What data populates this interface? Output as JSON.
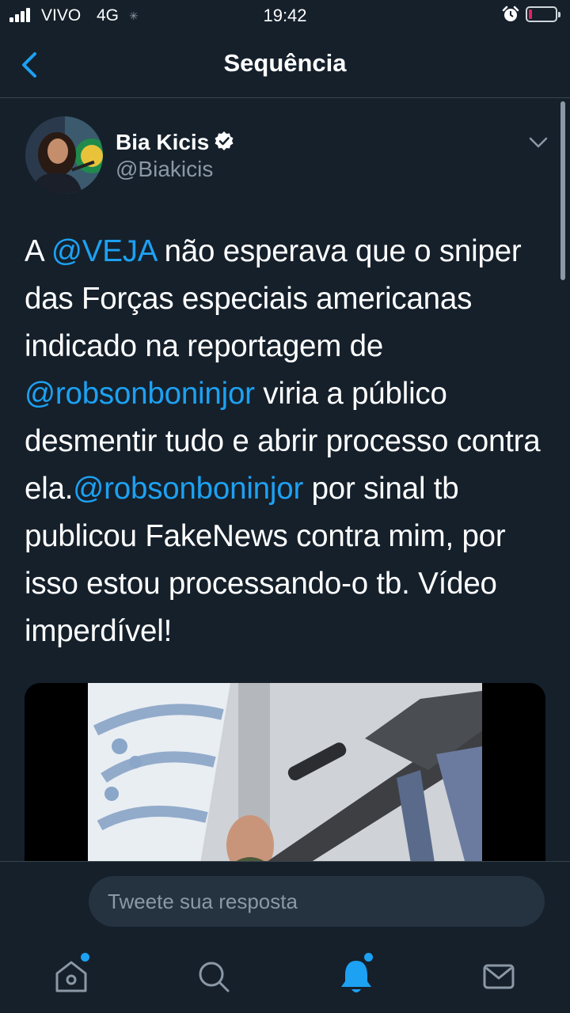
{
  "status_bar": {
    "carrier": "VIVO",
    "network": "4G",
    "time": "19:42",
    "icons": [
      "signal-icon",
      "loading-icon",
      "alarm-icon",
      "battery-icon"
    ]
  },
  "nav": {
    "title": "Sequência",
    "back_icon": "chevron-left-icon"
  },
  "tweet": {
    "author": {
      "name": "Bia Kicis",
      "handle": "@Biakicis",
      "verified": true
    },
    "text_segments": [
      {
        "text": "A ",
        "type": "plain"
      },
      {
        "text": "@VEJA",
        "type": "mention"
      },
      {
        "text": " não esperava que o sniper das Forças especiais americanas indicado na reportagem de ",
        "type": "plain"
      },
      {
        "text": "@robsonboninjor",
        "type": "mention"
      },
      {
        "text": " viria a público desmentir tudo e abrir processo contra ela.",
        "type": "plain"
      },
      {
        "text": "@robsonboninjor",
        "type": "mention"
      },
      {
        "text": " por sinal tb publicou FakeNews contra mim, por isso estou processando-o tb. Vídeo imperdível!",
        "type": "plain"
      }
    ],
    "media_type": "video"
  },
  "reply": {
    "placeholder": "Tweete sua resposta"
  },
  "tabbar": {
    "items": [
      {
        "name": "home",
        "icon": "home-icon",
        "has_dot": true
      },
      {
        "name": "search",
        "icon": "search-icon",
        "has_dot": false
      },
      {
        "name": "notifications",
        "icon": "bell-icon",
        "has_dot": true,
        "active": true
      },
      {
        "name": "messages",
        "icon": "mail-icon",
        "has_dot": false
      }
    ]
  },
  "colors": {
    "background": "#15202b",
    "accent": "#1da1f2",
    "secondary_text": "#8b98a5",
    "divider": "#38444d"
  }
}
